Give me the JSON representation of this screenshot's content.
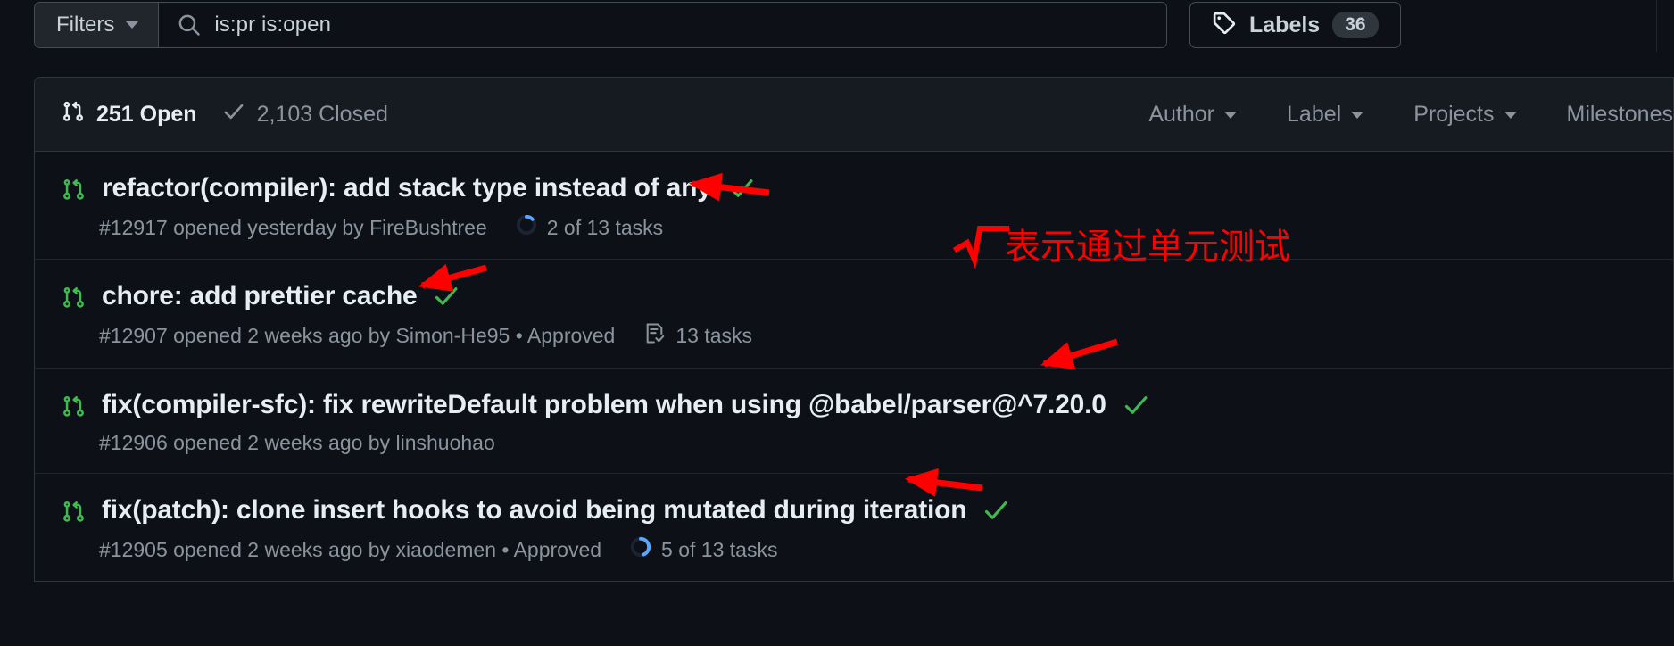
{
  "search": {
    "filters_label": "Filters",
    "query_value": "is:pr is:open",
    "search_icon": "search-icon",
    "caret_icon": "chevron-down-icon"
  },
  "labels_button": {
    "label": "Labels",
    "count": "36",
    "icon": "tag-icon"
  },
  "list_header": {
    "open": {
      "count_label": "251 Open",
      "icon": "pull-request-icon"
    },
    "closed": {
      "count_label": "2,103 Closed",
      "icon": "check-icon"
    },
    "dropdowns": [
      {
        "label": "Author"
      },
      {
        "label": "Label"
      },
      {
        "label": "Projects"
      },
      {
        "label": "Milestones"
      }
    ]
  },
  "pull_requests": [
    {
      "title": "refactor(compiler): add stack type instead of any",
      "checks_passed": true,
      "number": "#12917",
      "meta": "#12917 opened yesterday by FireBushtree",
      "approved": false,
      "tasks": {
        "type": "progress",
        "label": "2 of 13 tasks",
        "done": 2,
        "total": 13
      }
    },
    {
      "title": "chore: add prettier cache",
      "checks_passed": true,
      "number": "#12907",
      "meta": "#12907 opened 2 weeks ago by Simon-He95 • Approved",
      "approved": true,
      "tasks": {
        "type": "tasklist",
        "label": "13 tasks",
        "done": 13,
        "total": 13
      }
    },
    {
      "title": "fix(compiler-sfc): fix rewriteDefault problem when using @babel/parser@^7.20.0",
      "checks_passed": true,
      "number": "#12906",
      "meta": "#12906 opened 2 weeks ago by linshuohao",
      "approved": false,
      "tasks": null
    },
    {
      "title": "fix(patch): clone insert hooks to avoid being mutated during iteration",
      "checks_passed": true,
      "number": "#12905",
      "meta": "#12905 opened 2 weeks ago by xiaodemen • Approved",
      "approved": true,
      "tasks": {
        "type": "progress",
        "label": "5 of 13 tasks",
        "done": 5,
        "total": 13
      }
    }
  ],
  "annotations": {
    "radical_symbol": "√",
    "note_text": "表示通过单元测试",
    "color": "#ff0000"
  },
  "colors": {
    "page_background": "#0d1117",
    "panel_background": "#161b22",
    "border": "#30363d",
    "text_primary": "#e6edf3",
    "text_muted": "#8b949e",
    "pr_open_green": "#3fb950",
    "check_green": "#3fb950",
    "progress_blue": "#58a6ff",
    "annotation_red": "#ff0000"
  }
}
